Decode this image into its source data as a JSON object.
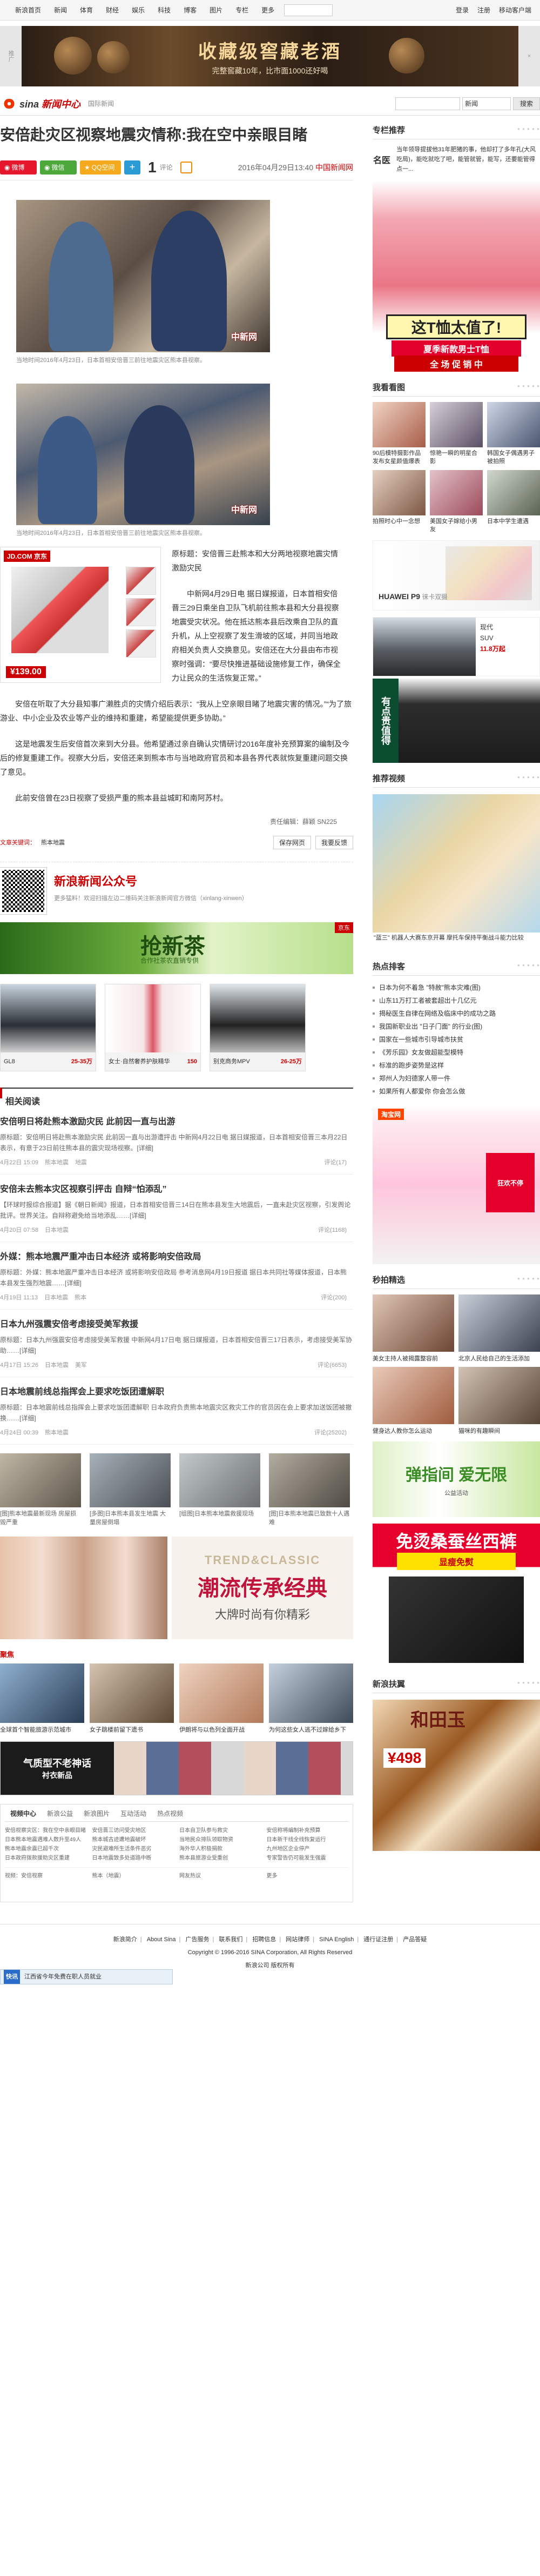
{
  "topnav": {
    "items": [
      "新浪首页",
      "新闻",
      "体育",
      "财经",
      "娱乐",
      "科技",
      "博客",
      "图片",
      "专栏",
      "更多"
    ],
    "right": [
      "登录",
      "注册",
      "移动客户端"
    ]
  },
  "ad_top": {
    "tag": "推广",
    "title": "收藏级窖藏老酒",
    "subtitle": "完整窖藏10年，比市面1000还好喝"
  },
  "site": {
    "logo_main": "新闻中心",
    "logo_sub": "国际新闻",
    "search_placeholder": "",
    "search_select": "新闻",
    "search_btn": "搜索"
  },
  "article": {
    "title": "安倍赴灾区视察地震灾情称:我在空中亲眼目睹",
    "share": {
      "weibo": "微博",
      "wechat": "微信",
      "qzone": "QQ空间"
    },
    "comments": "1",
    "comments_label": "评论",
    "date": "2016年04月29日13:40",
    "source": "中国新闻网",
    "photo1_caption": "当地时间2016年4月23日，日本首相安倍晋三前往地震灾区熊本县视察。",
    "photo2_caption": "当地时间2016年4月23日，日本首相安倍晋三前往地震灾区熊本县视察。",
    "paragraphs": [
      "原标题：安倍晋三赴熊本和大分两地视察地震灾情 激励灾民",
      "中新网4月29日电 据日媒报道，日本首相安倍晋三29日乘坐自卫队飞机前往熊本县和大分县视察地震受灾状况。他在抵达熊本县后改乘自卫队的直升机，从上空视察了发生滑坡的区域，并同当地政府相关负责人交换意见。安倍还在大分县由布市视察时强调：“要尽快推进基础设施修复工作，确保全力让民众的生活恢复正常。”",
      "安倍在听取了大分县知事广濑胜贞的灾情介绍后表示：“我从上空亲眼目睹了地震灾害的情况。”“为了旅游业、中小企业及农业等产业的维持和重建，希望能提供更多协助。”",
      "这是地震发生后安倍首次来到大分县。他希望通过亲自确认灾情研讨2016年度补充预算案的编制及今后的修复重建工作。视察大分后，安倍还来到熊本市与当地政府官员和本县各界代表就恢复重建问题交换了意见。",
      "此前安倍曾在23日视察了受损严重的熊本县益城町和南阿苏村。"
    ],
    "editor": "责任编辑：薛颖 SN225",
    "tags_label": "文章关键词：",
    "tags": [
      "熊本地震"
    ],
    "btn_save": "保存网页",
    "btn_report": "我要反馈"
  },
  "jd_ad": {
    "logo": "JD.COM 京东",
    "price": "¥139.00"
  },
  "wechat_box": {
    "title": "新浪新闻公众号",
    "desc": "更多猛料！欢迎扫描左边二维码关注新浪新闻官方微信（xinlang-xinwen）"
  },
  "tea_ad": {
    "title": "抢新茶",
    "sub": "合作社茶农直销专供",
    "tag": "京东"
  },
  "products": [
    {
      "name": "GL8",
      "price": "25-35万"
    },
    {
      "name": "女士·自然奢养护肤精华",
      "price": "150"
    },
    {
      "name": "别克商务MPV",
      "price": "26-25万"
    }
  ],
  "related": {
    "title": "相关阅读"
  },
  "news": [
    {
      "title": "安倍明日将赴熊本激励灾民 此前因一直与出游",
      "desc": "原标题：安倍明日将赴熊本激励灾民 此前因一直与出游遭抨击 中新网4月22日电 据日媒报道，日本首相安倍晋三本月22日表示，有意于23日前往熊本县的震灾现场视察。[详细]",
      "date": "4月22日 15:09",
      "tags": [
        "熊本地震",
        "地震"
      ],
      "comment": "评论(17)"
    },
    {
      "title": "安倍未去熊本灾区视察引抨击 自辩“怕添乱”",
      "desc": "【环球时报综合报道】据《朝日新闻》报道，日本首相安倍晋三14日在熊本县发生大地震后，一直未赴灾区视察，引发舆论批评。世界关注。自辩称避免给当地添乱……[详细]",
      "date": "4月20日 07:58",
      "tags": [
        "日本地震"
      ],
      "comment": "评论(1168)"
    },
    {
      "title": "外媒：熊本地震严重冲击日本经济 或将影响安倍政局",
      "desc": "原标题：外媒：熊本地震严重冲击日本经济 或将影响安倍政局 参考消息网4月19日报道 据日本共同社等媒体报道，日本熊本县发生强烈地震……[详细]",
      "date": "4月19日 11:13",
      "tags": [
        "日本地震",
        "熊本"
      ],
      "comment": "评论(200)"
    },
    {
      "title": "日本九州强震安倍考虑接受美军救援",
      "desc": "原标题：日本九州强震安倍考虑接受美军救援 中新网4月17日电 据日媒报道，日本首相安倍晋三17日表示，考虑接受美军协助……[详细]",
      "date": "4月17日 15:26",
      "tags": [
        "日本地震",
        "美军"
      ],
      "comment": "评论(6653)"
    },
    {
      "title": "日本地震前线总指挥会上要求吃饭团遭解职",
      "desc": "原标题：日本地震前线总指挥会上要求吃饭团遭解职 日本政府负责熊本地震灾区救灾工作的官员因在会上要求加送饭团被撤换……[详细]",
      "date": "4月24日 00:39",
      "tags": [
        "熊本地震"
      ],
      "comment": "评论(25202)"
    }
  ],
  "photo_row": [
    "[图]熊本地震最新现场 房屋损毁严重",
    "[多图]日本熊本县发生地震 大量房屋倒塌",
    "[组图]日本熊本地震救援现场",
    "[图]日本熊本地震已致数十人遇难"
  ],
  "trend_ad": {
    "a": "TREND&CLASSIC",
    "b": "潮流传承经典",
    "c": "大牌时尚有你精彩"
  },
  "jx": {
    "title": "聚焦",
    "items": [
      "全球首个智能旅游示范城市",
      "女子跳楼前留下遗书",
      "伊朗将与以色列全面开战",
      "为何这些女人逃不过嫁给乡下"
    ]
  },
  "shirt_ad": {
    "a": "气质型不老神话",
    "b": "衬衣新品"
  },
  "tabs": {
    "items": [
      "视频中心",
      "新浪公益",
      "新浪图片",
      "互动活动",
      "热点视频"
    ],
    "cols": [
      [
        "安倍视察灾区：我在空中亲眼目睹",
        "日本熊本地震遇难人数升至49人",
        "熊本地震余震已超千次",
        "日本政府拨款援助灾区重建"
      ],
      [
        "安倍晋三访问受灾地区",
        "熊本城古迹遭地震破坏",
        "灾民避难所生活条件恶劣",
        "日本地震致多处道路中断"
      ],
      [
        "日本自卫队参与救灾",
        "当地民众排队领取物资",
        "海外华人积极捐款",
        "熊本县旅游业受重创"
      ],
      [
        "安倍称将编制补充预算",
        "日本新干线全线恢复运行",
        "九州地区企业停产",
        "专家警告仍可能发生强震"
      ]
    ],
    "foot": [
      "视频：安倍视察",
      "熊本（地震）",
      "网友热议",
      "更多"
    ]
  },
  "side": {
    "promo_title": "专栏推荐",
    "promo_logo": "名医",
    "promo_text": "当年领导提拔他31年肥猪的事，他却打了多年孔(大风吃局)，能吃就吃了吧，能管就管，能写，还要能管得点一...",
    "big_ad": {
      "s1": "这T恤太值了!",
      "s2": "夏季新款男士T恤",
      "s3": "全 场 促 销 中"
    },
    "kan_title": "我看看图",
    "kan": [
      "90后模特摄影作品发布女星颜值爆表",
      "惊艳一瞬的明星合影",
      "韩国女子偶遇男子被拍照",
      "拍照时心中一念想",
      "美国女子嫁给小男友",
      "日本中学生遭遇"
    ],
    "huawei": {
      "brand": "HUAWEI P9",
      "tag": "徕卡双摄"
    },
    "car": {
      "name": "现代",
      "info": "SUV",
      "price": "11.8万起"
    },
    "shirt2": "有点贵值得",
    "video_title": "推荐视频",
    "video_cap": "\"蓝三\" 机器人大赛东京开幕 摩托车保持平衡战斗能力比较",
    "hot_title": "热点排客",
    "hot": [
      "日本为何不着急 \"特赦\"熊本灾难(图)",
      "山东11万打工者被套超出十几亿元",
      "揭秘医生自律在网络及临床中的成功之路",
      "我国新职业出 \"日子门面\" 的行业(图)",
      "国家在一些城市引导城市扶贫",
      "《芳乐园》女友做超能型模特",
      "标准的跑步姿势是这样",
      "郑州人为妇德家人带一件",
      "如果所有人都爱你 你会怎么做"
    ],
    "tb": "淘宝网",
    "tb_arrow": "狂欢不停",
    "sec_title": "秒拍精选",
    "sec": [
      "美女主持人被揭露整容前",
      "北京人民给自己的生活添加",
      "健身达人教你怎么运动",
      "猫咪的有趣瞬间"
    ],
    "green": {
      "a": "弹指间 爱无限",
      "b": "公益活动"
    },
    "pants": {
      "a": "免烫桑蚕丝西裤",
      "b": "显瘦免熨"
    },
    "jx_title": "新浪扶翼",
    "bracelet": {
      "t": "和田玉",
      "p": "¥498"
    }
  },
  "footer": {
    "links": [
      "新浪简介",
      "About Sina",
      "广告服务",
      "联系我们",
      "招聘信息",
      "网站律师",
      "SINA English",
      "通行证注册",
      "产品答疑"
    ],
    "copy": "Copyright © 1996-2016 SINA Corporation, All Rights Reserved",
    "tail": "新浪公司 版权所有",
    "bar": "江西省今年免费在职人员就业"
  }
}
